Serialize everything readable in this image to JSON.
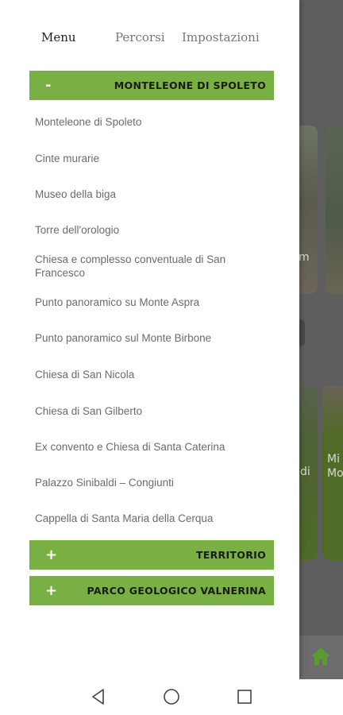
{
  "background": {
    "card1_text": "m",
    "card3_text": "di",
    "card4_text1": "Mi",
    "card4_text2": "Mo"
  },
  "tabs": [
    {
      "label": "Menu",
      "active": true
    },
    {
      "label": "Percorsi",
      "active": false
    },
    {
      "label": "Impostazioni",
      "active": false
    }
  ],
  "sections": {
    "monteleone": {
      "toggle": "-",
      "title": "MONTELEONE DI SPOLETO"
    },
    "territorio": {
      "toggle": "+",
      "title": "TERRITORIO"
    },
    "parco": {
      "toggle": "+",
      "title": "PARCO GEOLOGICO VALNERINA"
    }
  },
  "items": [
    "Monteleone di Spoleto",
    "Cinte murarie",
    "Museo della biga",
    "Torre dell'orologio",
    "Chiesa e complesso conventuale di San Francesco",
    "Punto panoramico su Monte Aspra",
    "Punto panoramico sul Monte Birbone",
    "Chiesa di San Nicola",
    "Chiesa di San Gilberto",
    "Ex convento e Chiesa di Santa Caterina",
    "Palazzo Sinibaldi – Congiunti",
    "Cappella di Santa Maria della Cerqua"
  ],
  "colors": {
    "accent": "#78b044",
    "home": "#5a9a2e"
  },
  "icons": {
    "back": "triangle-left",
    "home": "circle",
    "recents": "square",
    "app_home": "house"
  }
}
